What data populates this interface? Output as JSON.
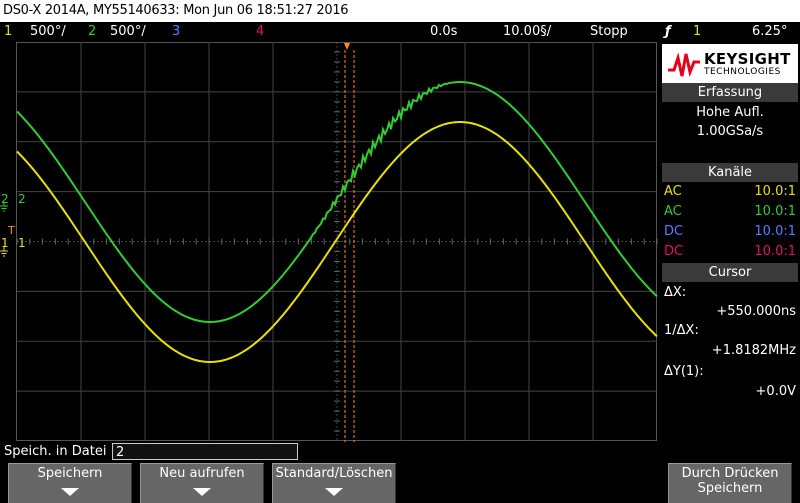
{
  "title": "DS0-X 2014A, MY55140633: Mon Jun 06 18:51:27 2016",
  "status": {
    "ch1_num": "1",
    "ch1_scale": "500°/",
    "ch2_num": "2",
    "ch2_scale": "500°/",
    "ch3_num": "3",
    "ch4_num": "4",
    "time_pos": "0.0s",
    "time_scale": "10.00§/",
    "run_state": "Stopp",
    "trig_icon": "ƒ",
    "trig_src": "1",
    "trig_level": "6.25°"
  },
  "colors": {
    "ch1": "#e8e000",
    "ch2": "#33cc33",
    "ch3": "#5a7aff",
    "ch4": "#e0106a",
    "trig": "#ff8c1a"
  },
  "screen_markers": {
    "ch2_marker": "2",
    "ch2_label": "2",
    "trig_t": "T",
    "ch1_marker": "1",
    "ch1_label": "1"
  },
  "panel": {
    "logo_name": "KEYSIGHT",
    "logo_sub": "TECHNOLOGIES",
    "acq_header": "Erfassung",
    "acq_mode": "Hohe Aufl.",
    "acq_rate": "1.00GSa/s",
    "chan_header": "Kanäle",
    "channels": [
      {
        "coupling": "AC",
        "probe": "10.0:1"
      },
      {
        "coupling": "AC",
        "probe": "10.0:1"
      },
      {
        "coupling": "DC",
        "probe": "10.0:1"
      },
      {
        "coupling": "DC",
        "probe": "10.0:1"
      }
    ],
    "cursor_header": "Cursor",
    "dx_label": "ΔX:",
    "dx_value": "+550.000ns",
    "inv_dx_label": "1/ΔX:",
    "inv_dx_value": "+1.8182MHz",
    "dy_label": "ΔY(1):",
    "dy_value": "+0.0V"
  },
  "save": {
    "label": "Speich. in Datei =",
    "value": "2"
  },
  "softkeys": [
    {
      "line1": "Speichern",
      "line2": ""
    },
    {
      "line1": "Neu aufrufen",
      "line2": ""
    },
    {
      "line1": "Standard/Löschen",
      "line2": ""
    },
    {
      "line1": "Durch Drücken",
      "line2": "Speichern"
    }
  ]
}
